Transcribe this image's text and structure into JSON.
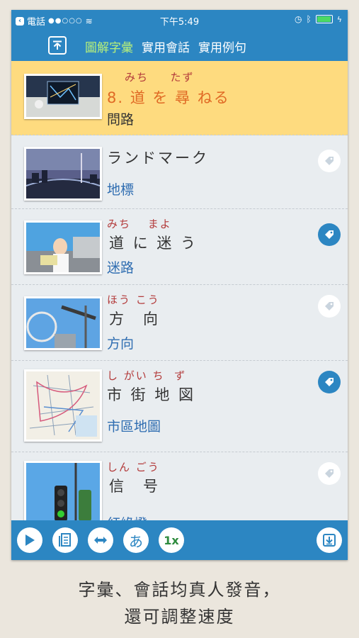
{
  "status_bar": {
    "back_app": "電話",
    "time": "下午5:49"
  },
  "nav": {
    "upload_icon": "upload-icon",
    "tabs": [
      {
        "label": "圖解字彙",
        "active": true
      },
      {
        "label": "實用會話",
        "active": false
      },
      {
        "label": "實用例句",
        "active": false
      }
    ]
  },
  "header_item": {
    "reading": "みち　  たず",
    "number_and_word": "8. 道 を 尋 ねる",
    "meaning": "問路"
  },
  "items": [
    {
      "reading": "",
      "word": "ランドマーク",
      "meaning": "地標",
      "tagged": false
    },
    {
      "reading": "みち　 まよ",
      "word": "道 に 迷 う",
      "meaning": "迷路",
      "tagged": true
    },
    {
      "reading": "ほう こう",
      "word": "方　向",
      "meaning": "方向",
      "tagged": false
    },
    {
      "reading": "し がい ち  ず",
      "word": "市 街 地 図",
      "meaning": "市區地圖",
      "tagged": true
    },
    {
      "reading": "しん ごう",
      "word": "信　号",
      "meaning": "紅綠燈",
      "tagged": false
    }
  ],
  "toolbar": {
    "speed_label": "1x",
    "kana_label": "あ"
  },
  "caption": {
    "line1": "字彙、會話均真人發音，",
    "line2": "還可調整速度"
  },
  "colors": {
    "primary": "#2c86c2",
    "highlight": "#fedb7f",
    "reading_red": "#b33b3b",
    "meaning_blue": "#2f6db1",
    "active_tab": "#b7f07a"
  }
}
